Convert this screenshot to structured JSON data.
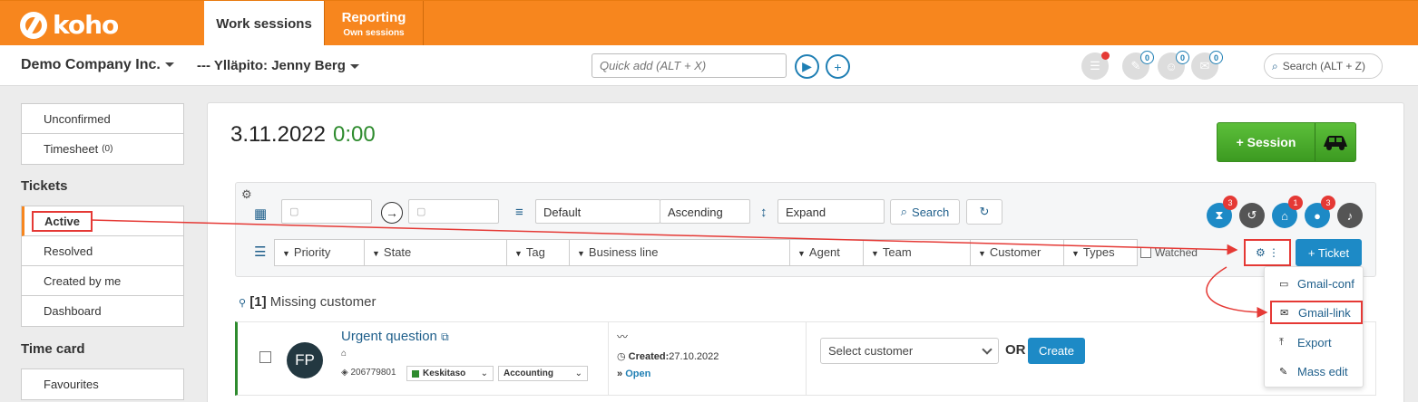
{
  "brand": {
    "logo_text": "koho"
  },
  "nav": {
    "work_sessions": "Work sessions",
    "reporting": "Reporting",
    "reporting_sub": "Own sessions"
  },
  "header": {
    "company": "Demo Company Inc.",
    "maintenance": "--- Ylläpito: Jenny Berg",
    "quick_add_placeholder": "Quick add (ALT + X)",
    "search_placeholder": "Search (ALT + Z)",
    "badges": [
      "0",
      "0",
      "0"
    ]
  },
  "sidebar": {
    "top_items": [
      {
        "label": "Unconfirmed"
      },
      {
        "label": "Timesheet",
        "count": "(0)"
      }
    ],
    "tickets_heading": "Tickets",
    "ticket_items": [
      "Active",
      "Resolved",
      "Created by me",
      "Dashboard"
    ],
    "timecard_heading": "Time card",
    "timecard_items": [
      "Favourites"
    ]
  },
  "main": {
    "date": "3.11.2022",
    "time": "0:00",
    "session_button": "+ Session"
  },
  "filters": {
    "sort_value": "Default",
    "order_value": "Ascending",
    "expand_value": "Expand",
    "search_button": "Search",
    "columns": [
      "Priority",
      "State",
      "Tag",
      "Business line",
      "Agent",
      "Team",
      "Customer",
      "Types"
    ],
    "watched_label": "Watched",
    "ticket_button": "+ Ticket",
    "status_badges": [
      "3",
      "1",
      "3"
    ]
  },
  "group": {
    "count": "[1]",
    "title": "Missing customer"
  },
  "ticket_row": {
    "avatar": "FP",
    "title": "Urgent question",
    "id": "206779801",
    "priority": "Keskitaso",
    "business_line": "Accounting",
    "created_label": "Created:",
    "created_date": "27.10.2022",
    "state": "Open",
    "select_customer": "Select customer",
    "or_label": "OR",
    "create_button": "Create"
  },
  "dropdown": {
    "items": [
      "Gmail-conf",
      "Gmail-link",
      "Export",
      "Mass edit"
    ]
  },
  "colors": {
    "brand_orange": "#f7861e",
    "primary_blue": "#1d8ac6",
    "success_green": "#4caf30",
    "annotation_red": "#e53935"
  }
}
